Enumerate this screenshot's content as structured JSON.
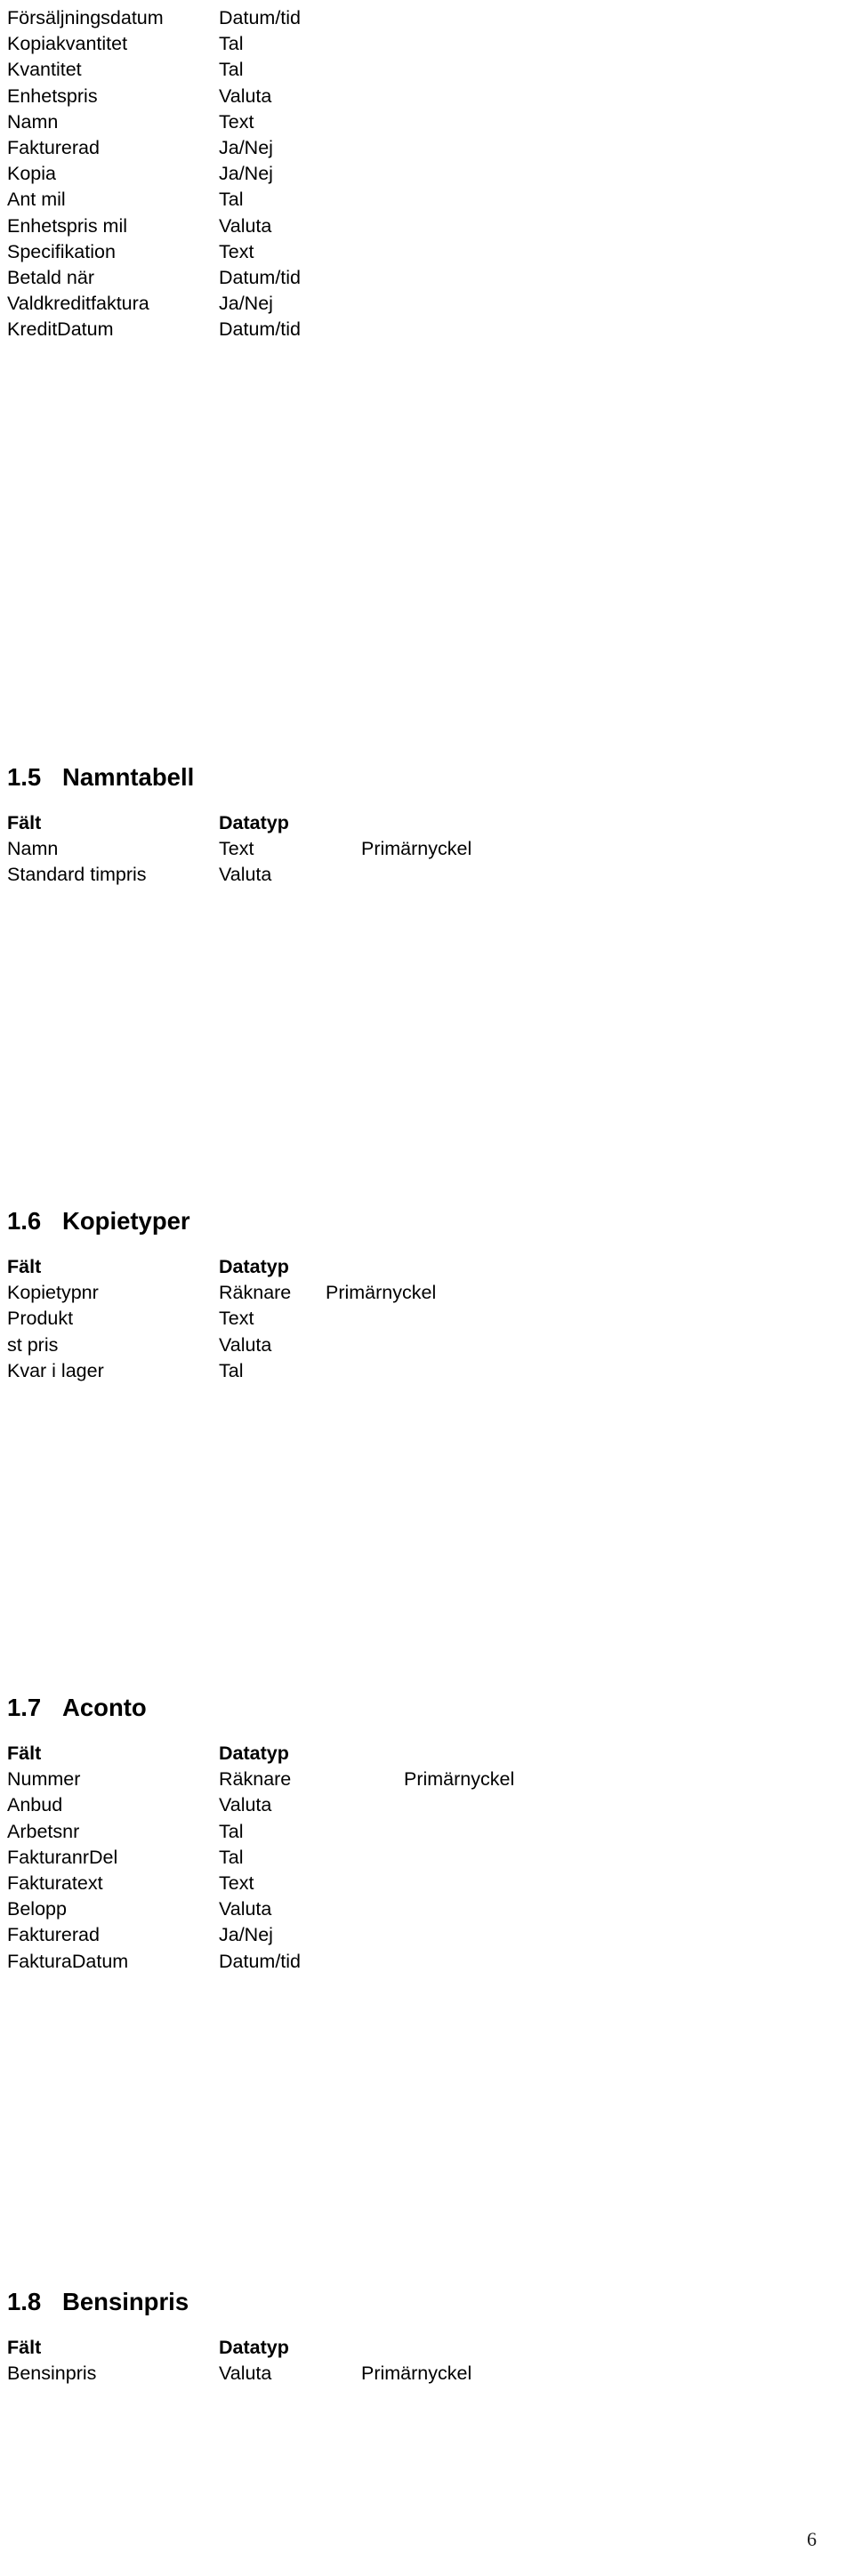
{
  "document": {
    "language": "sv",
    "page_number": "6",
    "column_headers": {
      "field": "Fält",
      "datatype": "Datatyp",
      "key": "Primärnyckel"
    }
  },
  "intro_table": {
    "rows": [
      {
        "field": "Försäljningsdatum",
        "datatype": "Datum/tid",
        "key": ""
      },
      {
        "field": "Kopiakvantitet",
        "datatype": "Tal",
        "key": ""
      },
      {
        "field": "Kvantitet",
        "datatype": "Tal",
        "key": ""
      },
      {
        "field": "Enhetspris",
        "datatype": "Valuta",
        "key": ""
      },
      {
        "field": "Namn",
        "datatype": "Text",
        "key": ""
      },
      {
        "field": "Fakturerad",
        "datatype": "Ja/Nej",
        "key": ""
      },
      {
        "field": "Kopia",
        "datatype": "Ja/Nej",
        "key": ""
      },
      {
        "field": "Ant mil",
        "datatype": "Tal",
        "key": ""
      },
      {
        "field": "Enhetspris mil",
        "datatype": "Valuta",
        "key": ""
      },
      {
        "field": "Specifikation",
        "datatype": "Text",
        "key": ""
      },
      {
        "field": "Betald när",
        "datatype": "Datum/tid",
        "key": ""
      },
      {
        "field": "Valdkreditfaktura",
        "datatype": "Ja/Nej",
        "key": ""
      },
      {
        "field": "KreditDatum",
        "datatype": "Datum/tid",
        "key": ""
      }
    ]
  },
  "sections": [
    {
      "id": "1.5",
      "number": "1.5",
      "title": "Namntabell",
      "headers": {
        "field": "Fält",
        "datatype": "Datatyp"
      },
      "rows": [
        {
          "field": "Namn",
          "datatype": "Text",
          "key": "Primärnyckel"
        },
        {
          "field": "Standard timpris",
          "datatype": "Valuta",
          "key": ""
        }
      ]
    },
    {
      "id": "1.6",
      "number": "1.6",
      "title": "Kopietyper",
      "headers": {
        "field": "Fält",
        "datatype": "Datatyp"
      },
      "rows": [
        {
          "field": "Kopietypnr",
          "datatype": "Räknare",
          "key": "Primärnyckel"
        },
        {
          "field": "Produkt",
          "datatype": "Text",
          "key": ""
        },
        {
          "field": "st pris",
          "datatype": "Valuta",
          "key": ""
        },
        {
          "field": "Kvar i lager",
          "datatype": "Tal",
          "key": ""
        }
      ]
    },
    {
      "id": "1.7",
      "number": "1.7",
      "title": "Aconto",
      "headers": {
        "field": "Fält",
        "datatype": "Datatyp"
      },
      "rows": [
        {
          "field": "Nummer",
          "datatype": "Räknare",
          "key": "Primärnyckel"
        },
        {
          "field": "Anbud",
          "datatype": "Valuta",
          "key": ""
        },
        {
          "field": "Arbetsnr",
          "datatype": "Tal",
          "key": ""
        },
        {
          "field": "FakturanrDel",
          "datatype": "Tal",
          "key": ""
        },
        {
          "field": "Fakturatext",
          "datatype": "Text",
          "key": ""
        },
        {
          "field": "Belopp",
          "datatype": "Valuta",
          "key": ""
        },
        {
          "field": "Fakturerad",
          "datatype": "Ja/Nej",
          "key": ""
        },
        {
          "field": "FakturaDatum",
          "datatype": "Datum/tid",
          "key": ""
        }
      ]
    },
    {
      "id": "1.8",
      "number": "1.8",
      "title": "Bensinpris",
      "headers": {
        "field": "Fält",
        "datatype": "Datatyp"
      },
      "rows": [
        {
          "field": "Bensinpris",
          "datatype": "Valuta",
          "key": "Primärnyckel"
        }
      ]
    }
  ]
}
